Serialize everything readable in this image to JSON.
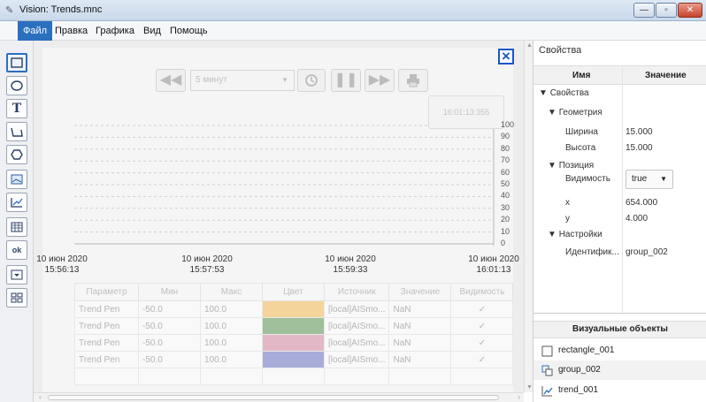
{
  "window": {
    "app_title": "Vision: Trends.mnc"
  },
  "menu": [
    "Файл",
    "Правка",
    "Графика",
    "Вид",
    "Помощь"
  ],
  "tools": [
    "rectangle-tool",
    "ellipse-tool",
    "text-tool",
    "polyline-tool",
    "polygon-tool",
    "image-tool",
    "trend-tool",
    "table-tool",
    "button-tool",
    "combobox-tool",
    "group-tool"
  ],
  "trend": {
    "interval_combo": "5 минут",
    "current_time": "16:01:13:355",
    "y_ticks": [
      "100",
      "90",
      "80",
      "70",
      "60",
      "50",
      "40",
      "30",
      "20",
      "10",
      "0"
    ],
    "x_ticks": [
      {
        "date": "10 июн 2020",
        "time": "15:56:13"
      },
      {
        "date": "10 июн 2020",
        "time": "15:57:53"
      },
      {
        "date": "10 июн 2020",
        "time": "15:59:33"
      },
      {
        "date": "10 июн 2020",
        "time": "16:01:13"
      }
    ],
    "table": {
      "headers": [
        "Параметр",
        "Мин",
        "Макс",
        "Цвет",
        "Источник",
        "Значение",
        "Видимость"
      ],
      "rows": [
        {
          "param": "Trend Pen",
          "min": "-50.0",
          "max": "100.0",
          "color": "#f4d49a",
          "source": "[local]AISmo...",
          "value": "NaN",
          "visible": "✓"
        },
        {
          "param": "Trend Pen",
          "min": "-50.0",
          "max": "100.0",
          "color": "#9fbf9a",
          "source": "[local]AISmo...",
          "value": "NaN",
          "visible": "✓"
        },
        {
          "param": "Trend Pen",
          "min": "-50.0",
          "max": "100.0",
          "color": "#e2b8c6",
          "source": "[local]AISmo...",
          "value": "NaN",
          "visible": "✓"
        },
        {
          "param": "Trend Pen",
          "min": "-50.0",
          "max": "100.0",
          "color": "#a7add8",
          "source": "[local]AISmo...",
          "value": "NaN",
          "visible": "✓"
        }
      ]
    }
  },
  "properties": {
    "title": "Свойства",
    "col_name": "Имя",
    "col_value": "Значение",
    "root": "Свойства",
    "geometry": "Геометрия",
    "width_label": "Ширина",
    "width_value": "15.000",
    "height_label": "Высота",
    "height_value": "15.000",
    "position": "Позиция",
    "visibility_label": "Видимость",
    "visibility_value": "true",
    "x_label": "x",
    "x_value": "654.000",
    "y_label": "y",
    "y_value": "4.000",
    "settings": "Настройки",
    "id_label": "Идентифик...",
    "id_value": "group_002"
  },
  "visual_objects": {
    "title": "Визуальные объекты",
    "items": [
      "rectangle_001",
      "group_002",
      "trend_001"
    ]
  }
}
